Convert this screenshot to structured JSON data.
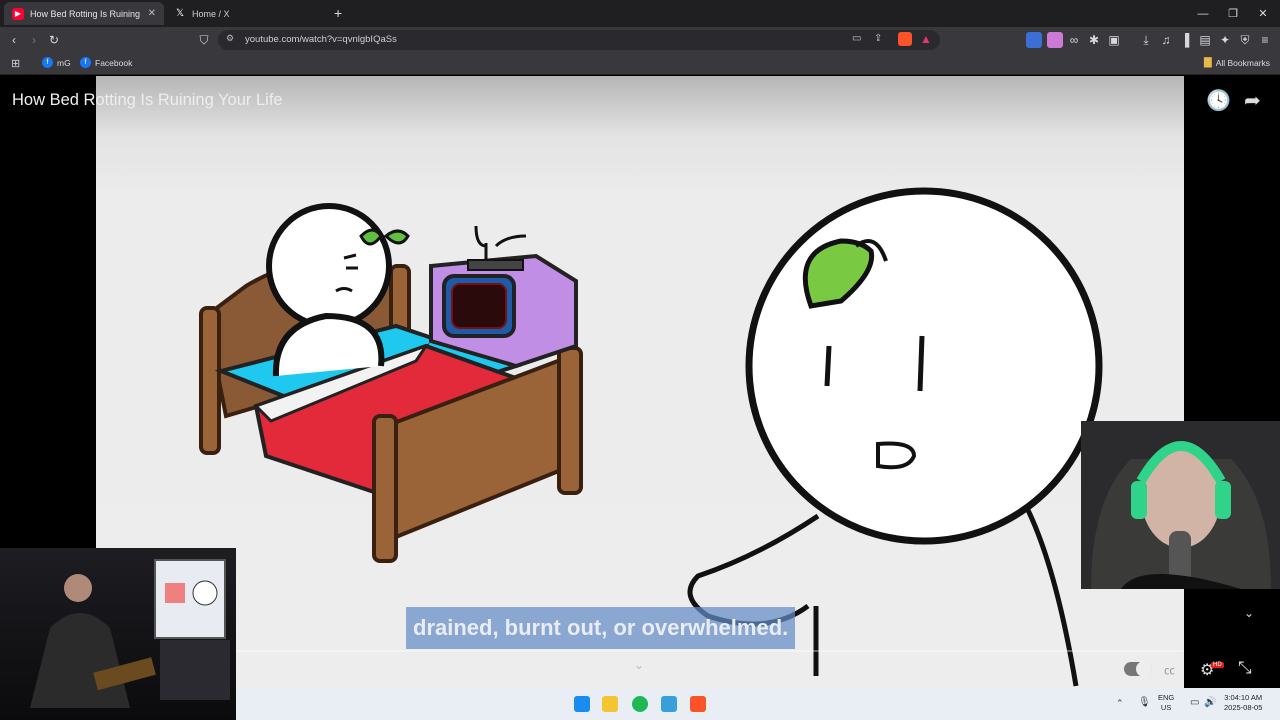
{
  "tabs": [
    {
      "label": "How Bed Rotting Is Ruining Y",
      "active": true
    },
    {
      "label": "Home / X",
      "active": false
    }
  ],
  "new_tab_label": "+",
  "address": {
    "url": "youtube.com/watch?v=qvnlgbIQaSs"
  },
  "bookmarks": [
    {
      "label": "mG",
      "icon": "facebook-icon"
    },
    {
      "label": "Facebook",
      "icon": "facebook-icon"
    }
  ],
  "all_bookmarks_label": "All Bookmarks",
  "video": {
    "title": "How Bed Rotting Is Ruining Your Life",
    "caption": "drained, burnt out, or overwhelmed.",
    "hd_badge": "HD",
    "progress": 0.0
  },
  "taskbar": {
    "lang_top": "ENG",
    "lang_bottom": "US",
    "time": "3:04:10 AM",
    "date": "2025-08-05"
  },
  "colors": {
    "accent_red": "#ff0033",
    "brave_orange": "#fb542b",
    "caption_bg": "#6c8cc8"
  }
}
